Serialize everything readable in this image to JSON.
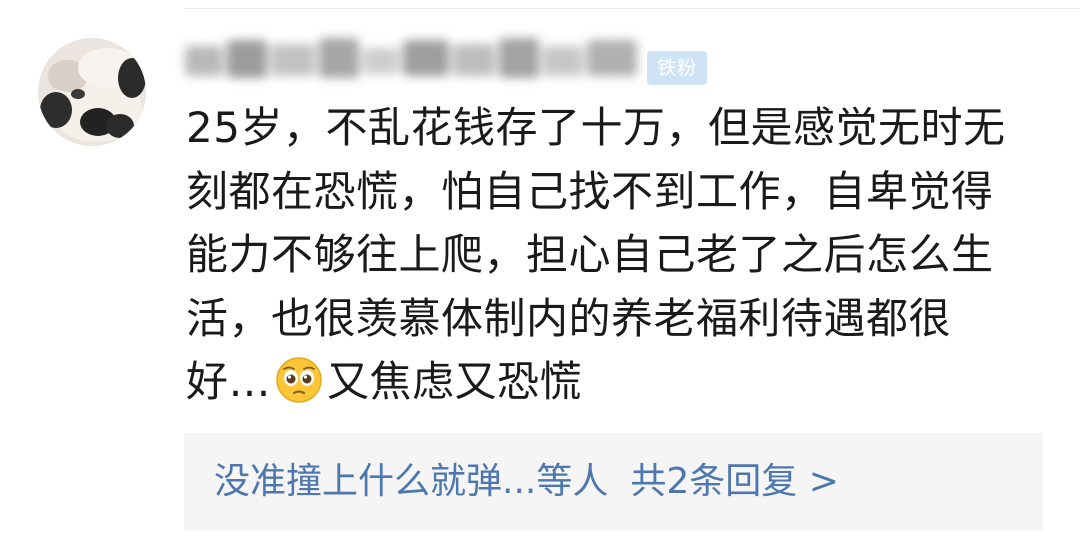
{
  "comment": {
    "author": {
      "name_blurred": true,
      "badge": "铁粉"
    },
    "text_lines": [
      "25岁，不乱花钱存了十万，但是感觉无时无",
      "刻都在恐慌，怕自己找不到工作，自卑觉得",
      "能力不够往上爬，担心自己老了之后怎么生",
      "活，也很羡慕体制内的养老福利待遇都很"
    ],
    "last_line_prefix": "好…",
    "last_line_emoji": "pleading-face-emoji",
    "last_line_suffix": "又焦虑又恐慌"
  },
  "replies": {
    "preview_user": "没准撞上什么就弹...",
    "preview_mid": "等人",
    "link": "共2条回复 >"
  },
  "colors": {
    "link": "#4d77ad",
    "text": "#1a1a1a",
    "reply_bg": "#f5f5f5",
    "badge_bg": "#cfe3f7"
  }
}
